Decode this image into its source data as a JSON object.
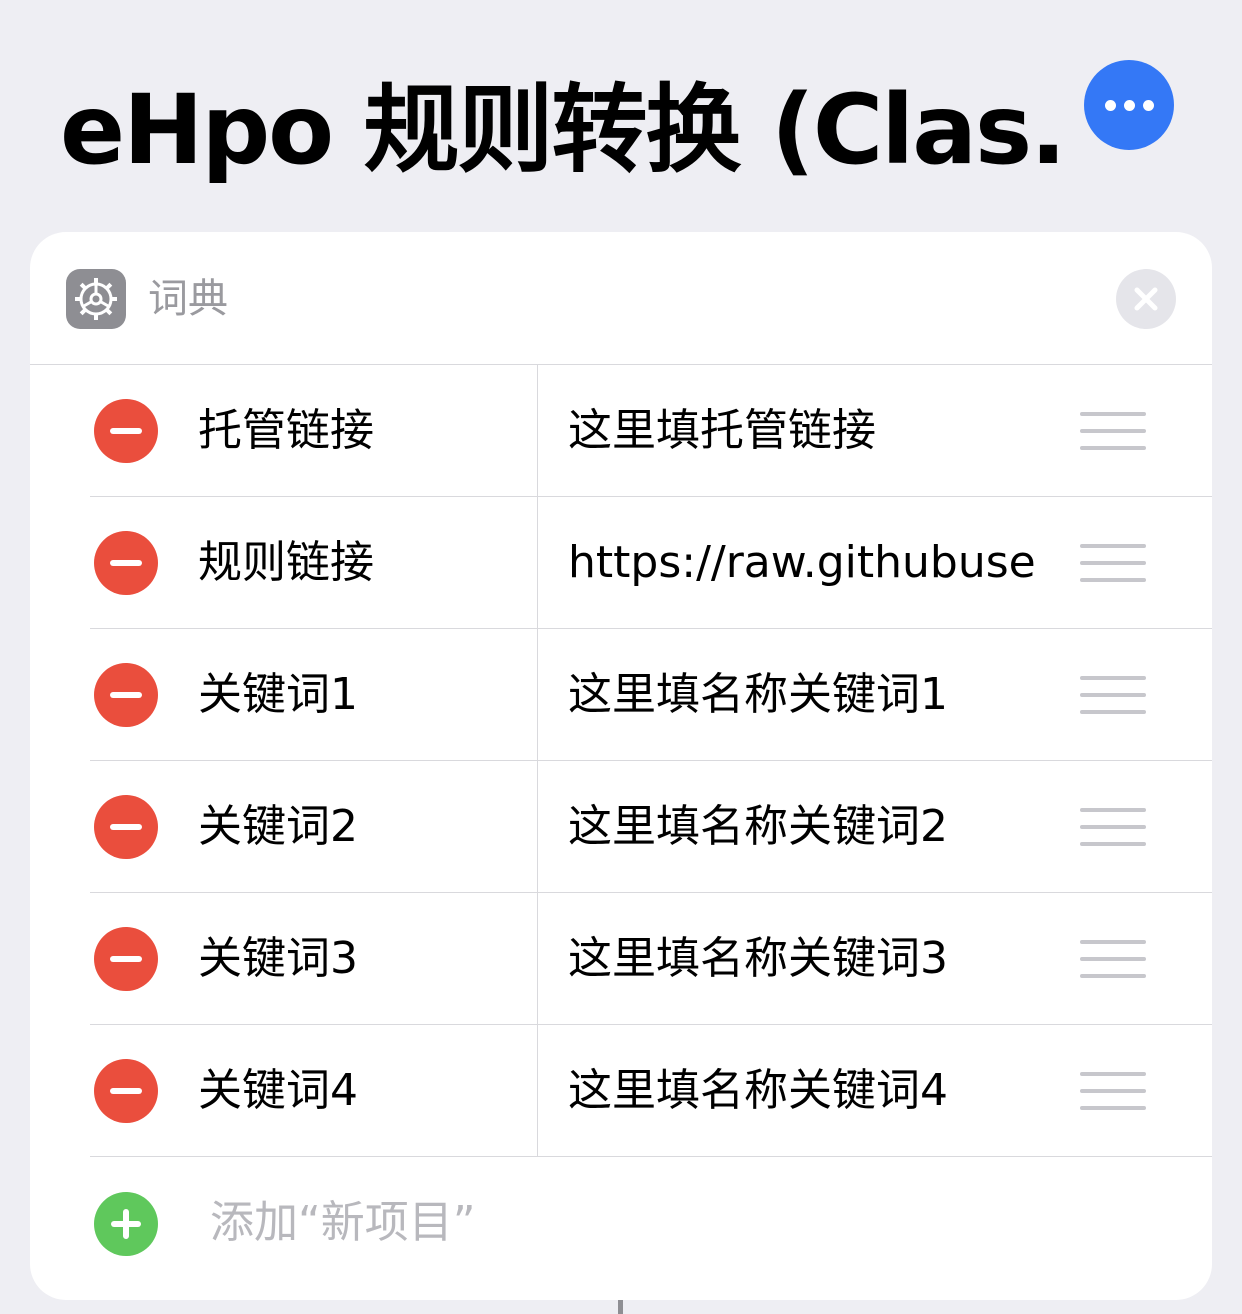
{
  "header": {
    "title": "eHpo 规则转换 (Clas..."
  },
  "card": {
    "title": "词典",
    "app_icon": "gear-icon",
    "close_icon": "close-icon"
  },
  "rows": [
    {
      "key": "托管链接",
      "value": "这里填托管链接"
    },
    {
      "key": "规则链接",
      "value": "https://raw.githubuse..."
    },
    {
      "key": "关键词1",
      "value": "这里填名称关键词1"
    },
    {
      "key": "关键词2",
      "value": "这里填名称关键词2"
    },
    {
      "key": "关键词3",
      "value": "这里填名称关键词3"
    },
    {
      "key": "关键词4",
      "value": "这里填名称关键词4"
    }
  ],
  "add_item": {
    "label": "添加“新项目”"
  },
  "colors": {
    "accent": "#3478f6",
    "remove": "#ea4e3d",
    "add": "#5fc85c",
    "background": "#eeeef3"
  }
}
